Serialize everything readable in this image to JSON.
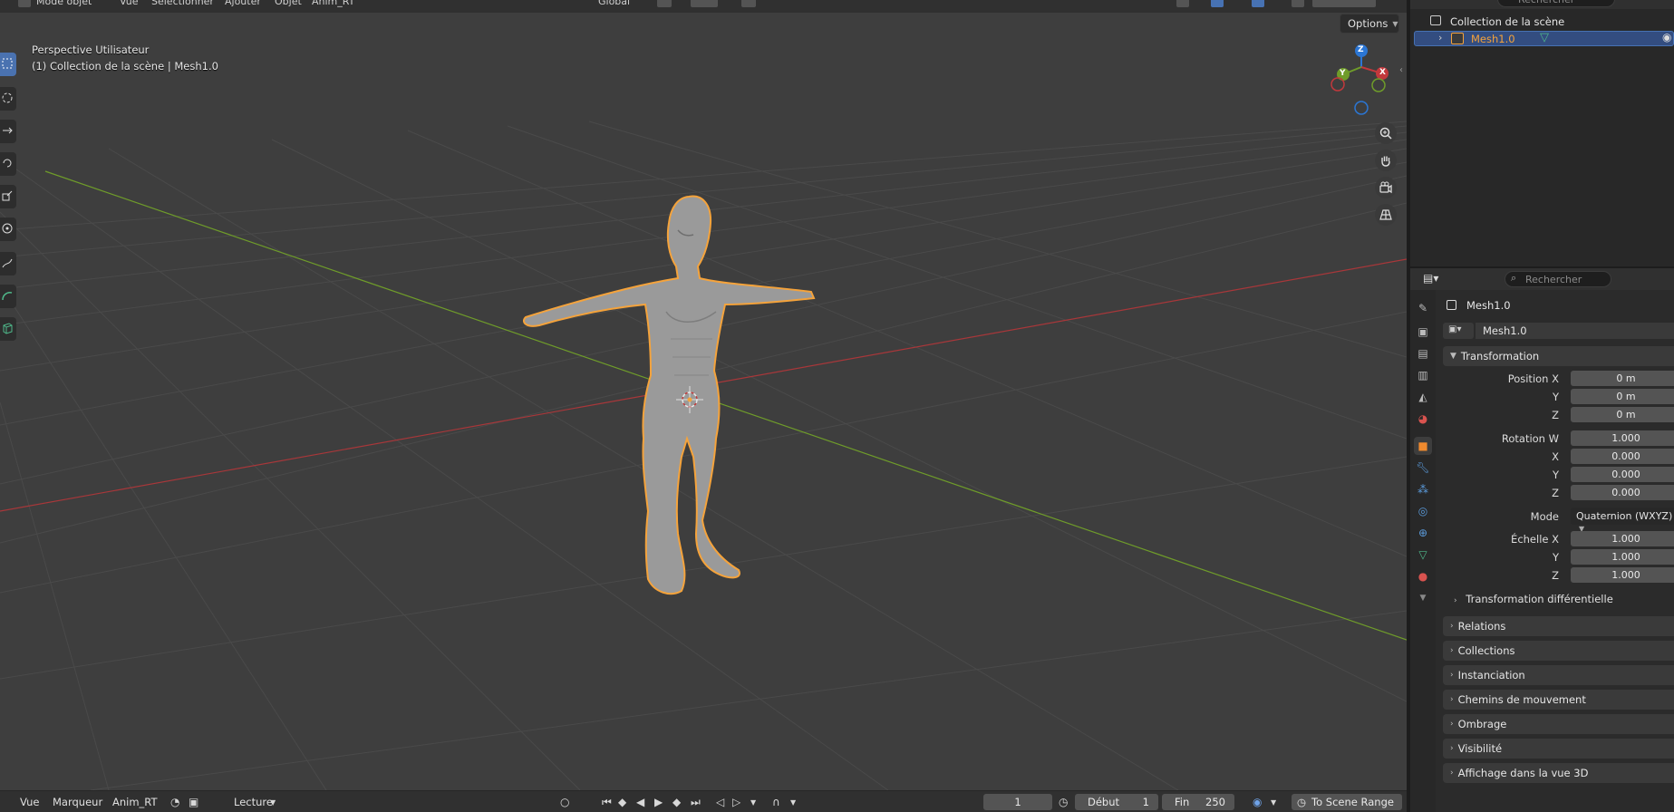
{
  "header": {
    "mode_label": "Mode objet",
    "menus": [
      "Vue",
      "Sélectionner",
      "Ajouter",
      "Objet",
      "Anim_RT"
    ],
    "orientation": "Global"
  },
  "viewport": {
    "view_name": "Perspective Utilisateur",
    "context": "(1) Collection de la scène | Mesh1.0",
    "options_label": "Options",
    "gizmo": {
      "x": "X",
      "y": "Y",
      "z": "Z"
    },
    "colors": {
      "x_axis": "#c2383c",
      "y_axis": "#6f9c2a",
      "z_axis": "#2b76d4",
      "selection": "#f5a33b"
    }
  },
  "outliner": {
    "search_placeholder": "Rechercher",
    "collection": "Collection de la scène",
    "object": "Mesh1.0"
  },
  "properties": {
    "search_placeholder": "Rechercher",
    "object_name": "Mesh1.0",
    "datablock_name": "Mesh1.0",
    "transform": {
      "title": "Transformation",
      "position": {
        "label": "Position X",
        "x": "0 m",
        "y": "0 m",
        "z": "0 m"
      },
      "rotation": {
        "label": "Rotation W",
        "w": "1.000",
        "x": "0.000",
        "y": "0.000",
        "z": "0.000"
      },
      "mode_label": "Mode",
      "mode_value": "Quaternion (WXYZ)",
      "scale": {
        "label": "Échelle X",
        "x": "1.000",
        "y": "1.000",
        "z": "1.000"
      },
      "axis_y": "Y",
      "axis_z": "Z",
      "axis_x": "X",
      "delta": "Transformation différentielle"
    },
    "panels": [
      "Relations",
      "Collections",
      "Instanciation",
      "Chemins de mouvement",
      "Ombrage",
      "Visibilité",
      "Affichage dans la vue 3D"
    ]
  },
  "timeline": {
    "menus": [
      "Vue",
      "Marqueur",
      "Anim_RT"
    ],
    "playback": "Lecture",
    "current_frame": "1",
    "start_label": "Début",
    "start": "1",
    "end_label": "Fin",
    "end": "250",
    "range_label": "To Scene Range"
  }
}
